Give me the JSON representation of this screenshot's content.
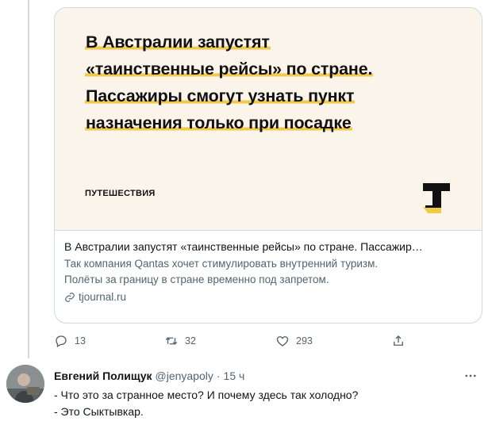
{
  "card": {
    "headline_lines": [
      "В Австралии запустят",
      "«таинственные рейсы» по стране.",
      "Пассажиры смогут узнать пункт",
      "назначения только при посадке"
    ],
    "category": "ПУТЕШЕСТВИЯ",
    "logo_icon": "tjournal-logo",
    "accent_color": "#f1c94b",
    "title": "В Австралии запустят «таинственные рейсы» по стране. Пассажир…",
    "description_lines": [
      "Так компания Qantas хочет стимулировать внутренний туризм.",
      "Полёты за границу в стране временно под запретом."
    ],
    "link": "tjournal.ru"
  },
  "actions": {
    "reply_count": "13",
    "retweet_count": "32",
    "like_count": "293"
  },
  "reply": {
    "name": "Евгений Полищук",
    "handle": "@jenyapoly",
    "dot": "·",
    "time": "15 ч",
    "lines": [
      "- Что это за странное место? И почему здесь так холодно?",
      "- Это Сыктывкар."
    ]
  }
}
